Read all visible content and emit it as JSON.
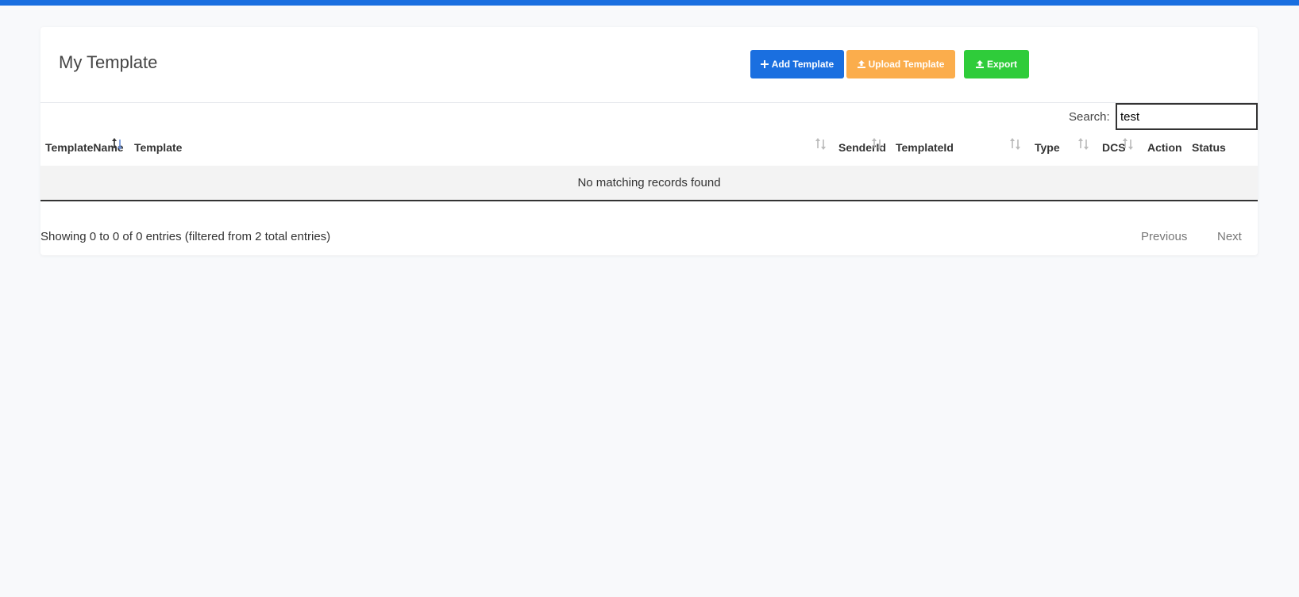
{
  "page": {
    "title": "My Template"
  },
  "toolbar": {
    "add_label": "Add Template",
    "upload_label": "Upload Template",
    "export_label": "Export"
  },
  "search": {
    "label": "Search:",
    "value": "test"
  },
  "table": {
    "columns": [
      "TemplateName",
      "Template",
      "SenderId",
      "TemplateId",
      "Type",
      "DCS",
      "Action",
      "Status"
    ],
    "empty_message": "No matching records found"
  },
  "footer": {
    "info": "Showing 0 to 0 of 0 entries (filtered from 2 total entries)",
    "previous": "Previous",
    "next": "Next"
  },
  "colors": {
    "accent": "#1a6fe0",
    "upload": "#fbad4c",
    "export": "#2fcc3a"
  }
}
